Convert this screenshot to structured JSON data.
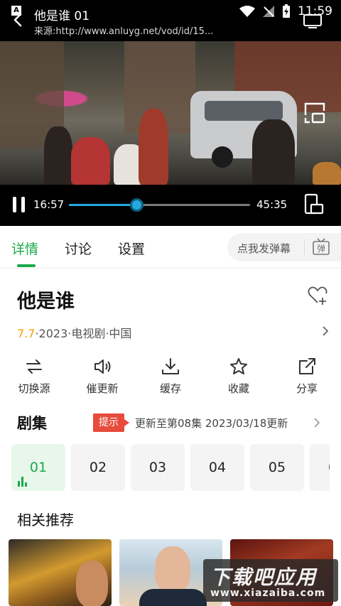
{
  "status_bar": {
    "time": "11:59"
  },
  "player": {
    "app_badge": "A",
    "title": "他是谁 01",
    "source": "来源:http://www.anluyg.net/vod/id/15...",
    "current_time": "16:57",
    "total_time": "45:35",
    "progress_fraction": 0.373
  },
  "tabs": {
    "items": [
      {
        "label": "详情",
        "active": true
      },
      {
        "label": "讨论",
        "active": false
      },
      {
        "label": "设置",
        "active": false
      }
    ],
    "danmaku_button": "点我发弹幕",
    "danmaku_icon_text": "弹"
  },
  "detail": {
    "title": "他是谁",
    "score": "7.7",
    "meta": "·2023·电视剧·中国"
  },
  "actions": [
    {
      "label": "切换源",
      "icon": "switch-source-icon"
    },
    {
      "label": "催更新",
      "icon": "speaker-icon"
    },
    {
      "label": "缓存",
      "icon": "download-icon"
    },
    {
      "label": "收藏",
      "icon": "star-icon"
    },
    {
      "label": "分享",
      "icon": "share-icon"
    }
  ],
  "episodes": {
    "title": "剧集",
    "tip": "提示",
    "update": "更新至第08集  2023/03/18更新",
    "items": [
      "01",
      "02",
      "03",
      "04",
      "05",
      "0"
    ],
    "active_index": 0
  },
  "related": {
    "title": "相关推荐"
  },
  "watermark": {
    "main": "下载吧应用",
    "url": "www.xiazaiba.com"
  },
  "colors": {
    "accent": "#1aa94a",
    "progress": "#25a8e0",
    "score": "#f2a300",
    "tip": "#e64b3c"
  }
}
